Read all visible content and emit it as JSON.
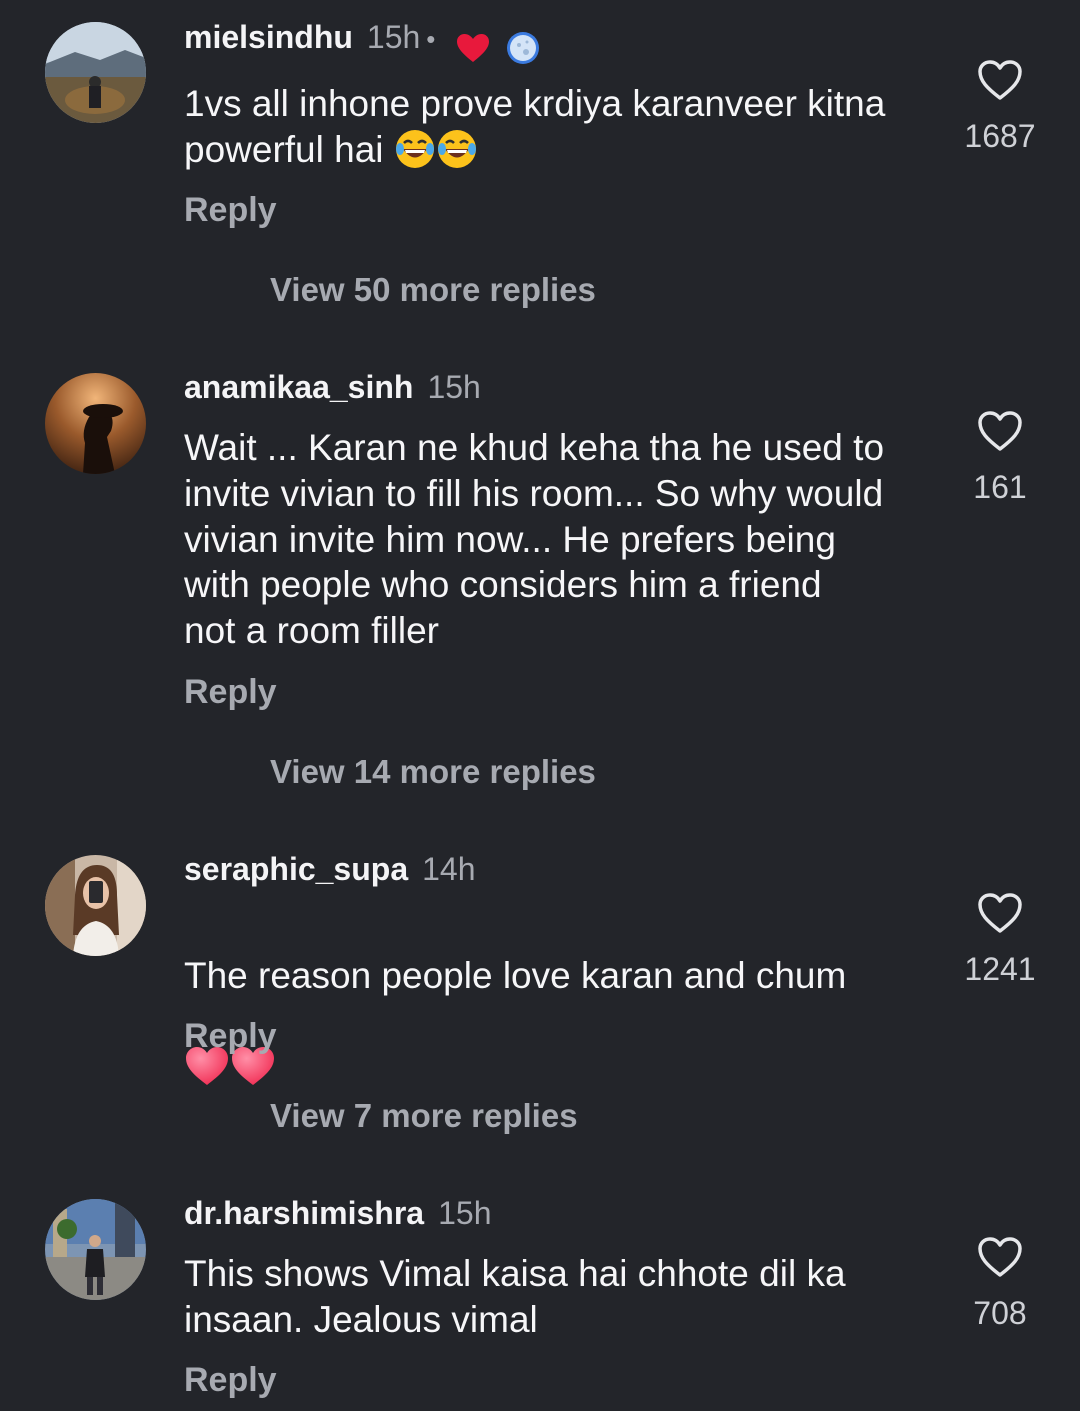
{
  "comments": [
    {
      "username": "mielsindhu",
      "time": "15h",
      "dot": "•",
      "text": "1vs all inhone prove krdiya karanveer kitna\npowerful hai",
      "emoji_icons": [
        "face-with-tears-of-joy-icon",
        "face-with-tears-of-joy-icon"
      ],
      "like_count": "1687",
      "reply_label": "Reply",
      "view_replies": "View 50 more replies",
      "badges": [
        "red-heart-icon",
        "blue-moon-icon"
      ]
    },
    {
      "username": "anamikaa_sinh",
      "time": "15h",
      "text": "Wait ... Karan ne khud keha tha he used to\ninvite vivian to fill his room... So why would\nvivian invite him now... He prefers being\nwith people who considers him a friend\nnot a room filler",
      "like_count": "161",
      "reply_label": "Reply",
      "view_replies": "View 14 more replies"
    },
    {
      "username": "seraphic_supa",
      "time": "14h",
      "text": "The reason people love karan and chum",
      "emoji_icons": [
        "pink-heart-icon",
        "pink-heart-icon"
      ],
      "like_count": "1241",
      "reply_label": "Reply",
      "view_replies": "View 7 more replies"
    },
    {
      "username": "dr.harshimishra",
      "time": "15h",
      "text": "This shows Vimal kaisa hai chhote dil ka\ninsaan. Jealous vimal",
      "like_count": "708",
      "reply_label": "Reply"
    }
  ],
  "colors": {
    "background": "#23252a",
    "primary_text": "#f6f6f8",
    "secondary_text": "#a7aab1",
    "heart_red": "#e8193c",
    "pink_heart": "#f7355f"
  }
}
